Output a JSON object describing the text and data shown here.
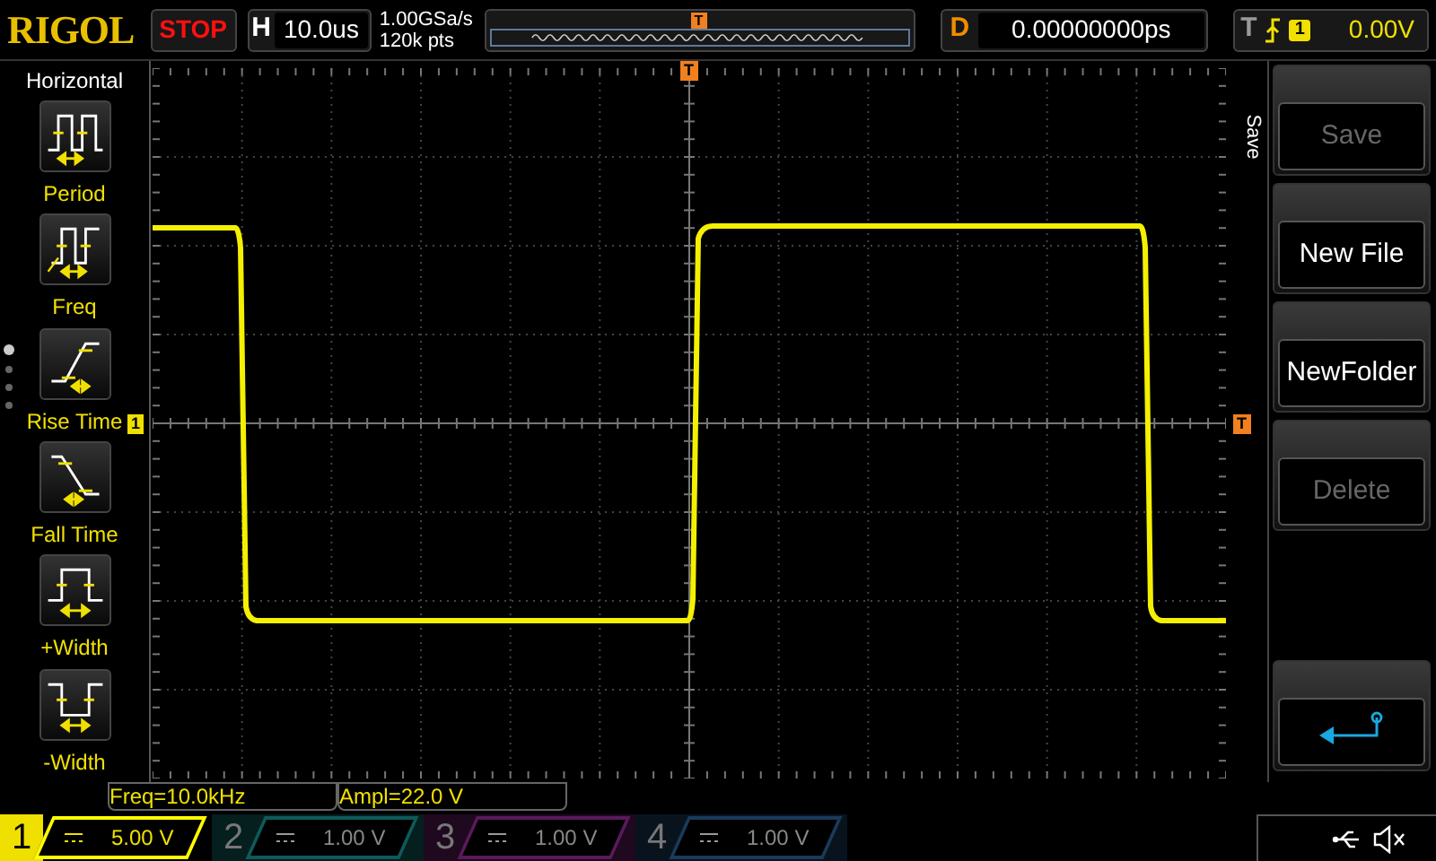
{
  "brand": "RIGOL",
  "run_state": {
    "label": "STOP"
  },
  "timebase": {
    "label": "H",
    "value": "10.0us"
  },
  "acquisition": {
    "sample_rate": "1.00GSa/s",
    "memory_depth": "120k pts"
  },
  "memory_bar": {
    "trigger_marker": "T"
  },
  "delay": {
    "label": "D",
    "value": "0.00000000ps"
  },
  "trigger": {
    "label": "T",
    "source": "1",
    "voltage": "0.00V"
  },
  "left_menu": {
    "title": "Horizontal",
    "items": [
      {
        "label": "Period",
        "kind": "period"
      },
      {
        "label": "Freq",
        "kind": "freq"
      },
      {
        "label": "Rise Time",
        "kind": "rise"
      },
      {
        "label": "Fall Time",
        "kind": "fall"
      },
      {
        "label": "+Width",
        "kind": "pwidth"
      },
      {
        "label": "-Width",
        "kind": "nwidth"
      }
    ],
    "pages": [
      {
        "selected": true
      },
      {
        "selected": false
      },
      {
        "selected": false
      },
      {
        "selected": false
      }
    ]
  },
  "scope": {
    "trigger_position_marker": "T",
    "channel_marker": "1",
    "trigger_level_marker": "T"
  },
  "right_menu": {
    "title": "Save",
    "items": [
      {
        "kind": "text",
        "label": "Save",
        "disabled": true
      },
      {
        "kind": "text",
        "label": "New File",
        "disabled": false
      },
      {
        "kind": "text",
        "label": "NewFolder",
        "disabled": false
      },
      {
        "kind": "text",
        "label": "Delete",
        "disabled": true
      },
      {
        "kind": "back"
      }
    ]
  },
  "measurements": [
    "Freq=10.0kHz",
    "Ampl=22.0 V"
  ],
  "channels": [
    {
      "number": "1",
      "scale": "5.00 V",
      "on": true,
      "color": "#ffff00"
    },
    {
      "number": "2",
      "scale": "1.00 V",
      "on": false,
      "color": "#0e5a5a"
    },
    {
      "number": "3",
      "scale": "1.00 V",
      "on": false,
      "color": "#5a1a5a"
    },
    {
      "number": "4",
      "scale": "1.00 V",
      "on": false,
      "color": "#1a3a5a"
    }
  ]
}
